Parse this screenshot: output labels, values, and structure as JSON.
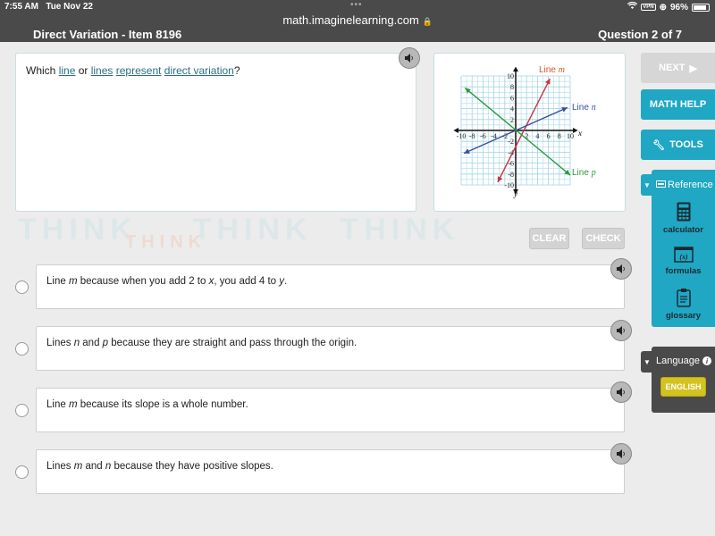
{
  "status_bar": {
    "time": "7:55 AM",
    "date": "Tue Nov 22",
    "url": "math.imaginelearning.com",
    "vpn_label": "VPN",
    "battery": "96%"
  },
  "header": {
    "title": "Direct Variation - Item 8196",
    "progress": "Question 2 of 7"
  },
  "question": {
    "prefix": "Which ",
    "word1": "line",
    "mid1": " or ",
    "word2": "lines",
    "space": " ",
    "word3": "represent",
    "word4": "direct variation",
    "suffix": "?"
  },
  "graph": {
    "line_m_label": "Line ",
    "line_m_var": "m",
    "line_n_label": "Line ",
    "line_n_var": "n",
    "line_p_label": "Line ",
    "line_p_var": "p",
    "x_axis": "x",
    "y_axis": "y",
    "x_ticks": [
      "-10",
      "-8",
      "-6",
      "-4",
      "-2",
      "2",
      "4",
      "6",
      "8",
      "10"
    ],
    "y_ticks": [
      "10",
      "8",
      "6",
      "4",
      "2",
      "-2",
      "-4",
      "-6",
      "-8",
      "-10"
    ],
    "colors": {
      "m": "#c8373f",
      "n": "#3a4fa0",
      "p": "#2a9a3a"
    }
  },
  "chart_data": {
    "type": "line",
    "title": "",
    "xlabel": "x",
    "ylabel": "y",
    "xlim": [
      -10,
      10
    ],
    "ylim": [
      -10,
      10
    ],
    "grid": true,
    "series": [
      {
        "name": "Line m",
        "points": [
          [
            -3.3,
            -9.5
          ],
          [
            6.3,
            9.5
          ]
        ]
      },
      {
        "name": "Line n",
        "points": [
          [
            -9.5,
            -4.2
          ],
          [
            9.5,
            4.2
          ]
        ]
      },
      {
        "name": "Line p",
        "points": [
          [
            -9.3,
            7.8
          ],
          [
            10,
            -8.2
          ]
        ]
      }
    ]
  },
  "actions": {
    "clear": "CLEAR",
    "check": "CHECK"
  },
  "choices": [
    {
      "parts": [
        "Line ",
        "m",
        " because when you add 2 to ",
        "x",
        ", you add 4 to ",
        "y",
        "."
      ]
    },
    {
      "parts": [
        "Lines ",
        "n",
        " and ",
        "p",
        " because they are straight and pass through the origin.",
        "",
        ""
      ]
    },
    {
      "parts": [
        "Line ",
        "m",
        " because its slope is a whole number.",
        "",
        "",
        "",
        ""
      ]
    },
    {
      "parts": [
        "Lines ",
        "m",
        " and ",
        "n",
        " because they have positive slopes.",
        "",
        ""
      ]
    }
  ],
  "sidebar": {
    "next": "NEXT",
    "math_help": "MATH HELP",
    "tools": "TOOLS",
    "reference": "Reference",
    "ref_items": [
      "calculator",
      "formulas",
      "glossary"
    ],
    "formula_glyph": "(x)",
    "language": "Language",
    "english": "ENGLISH"
  }
}
